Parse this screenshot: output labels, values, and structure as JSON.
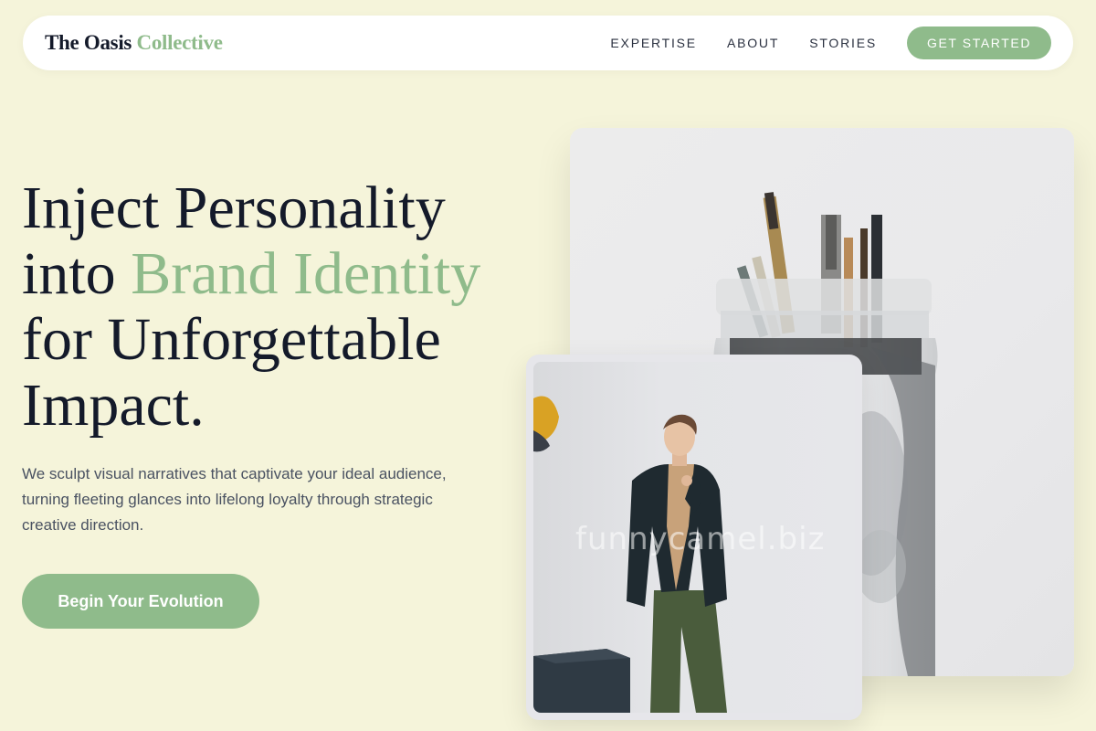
{
  "nav": {
    "brand_part1": "The Oasis",
    "brand_part2": "Collective",
    "links": [
      "EXPERTISE",
      "ABOUT",
      "STORIES"
    ],
    "cta": "GET STARTED"
  },
  "hero": {
    "title_line1": "Inject Personality",
    "title_line2_prefix": "into ",
    "title_line2_accent": "Brand Identity",
    "title_line3": "for Unforgettable",
    "title_line4": "Impact.",
    "description": "We sculpt visual narratives that captivate your ideal audience, turning fleeting glances into lifelong loyalty through strategic creative direction.",
    "button": "Begin Your Evolution"
  },
  "watermark": "funnycamel.biz",
  "colors": {
    "background": "#f5f4da",
    "accent": "#8fbb8b",
    "text": "#141a2a"
  }
}
